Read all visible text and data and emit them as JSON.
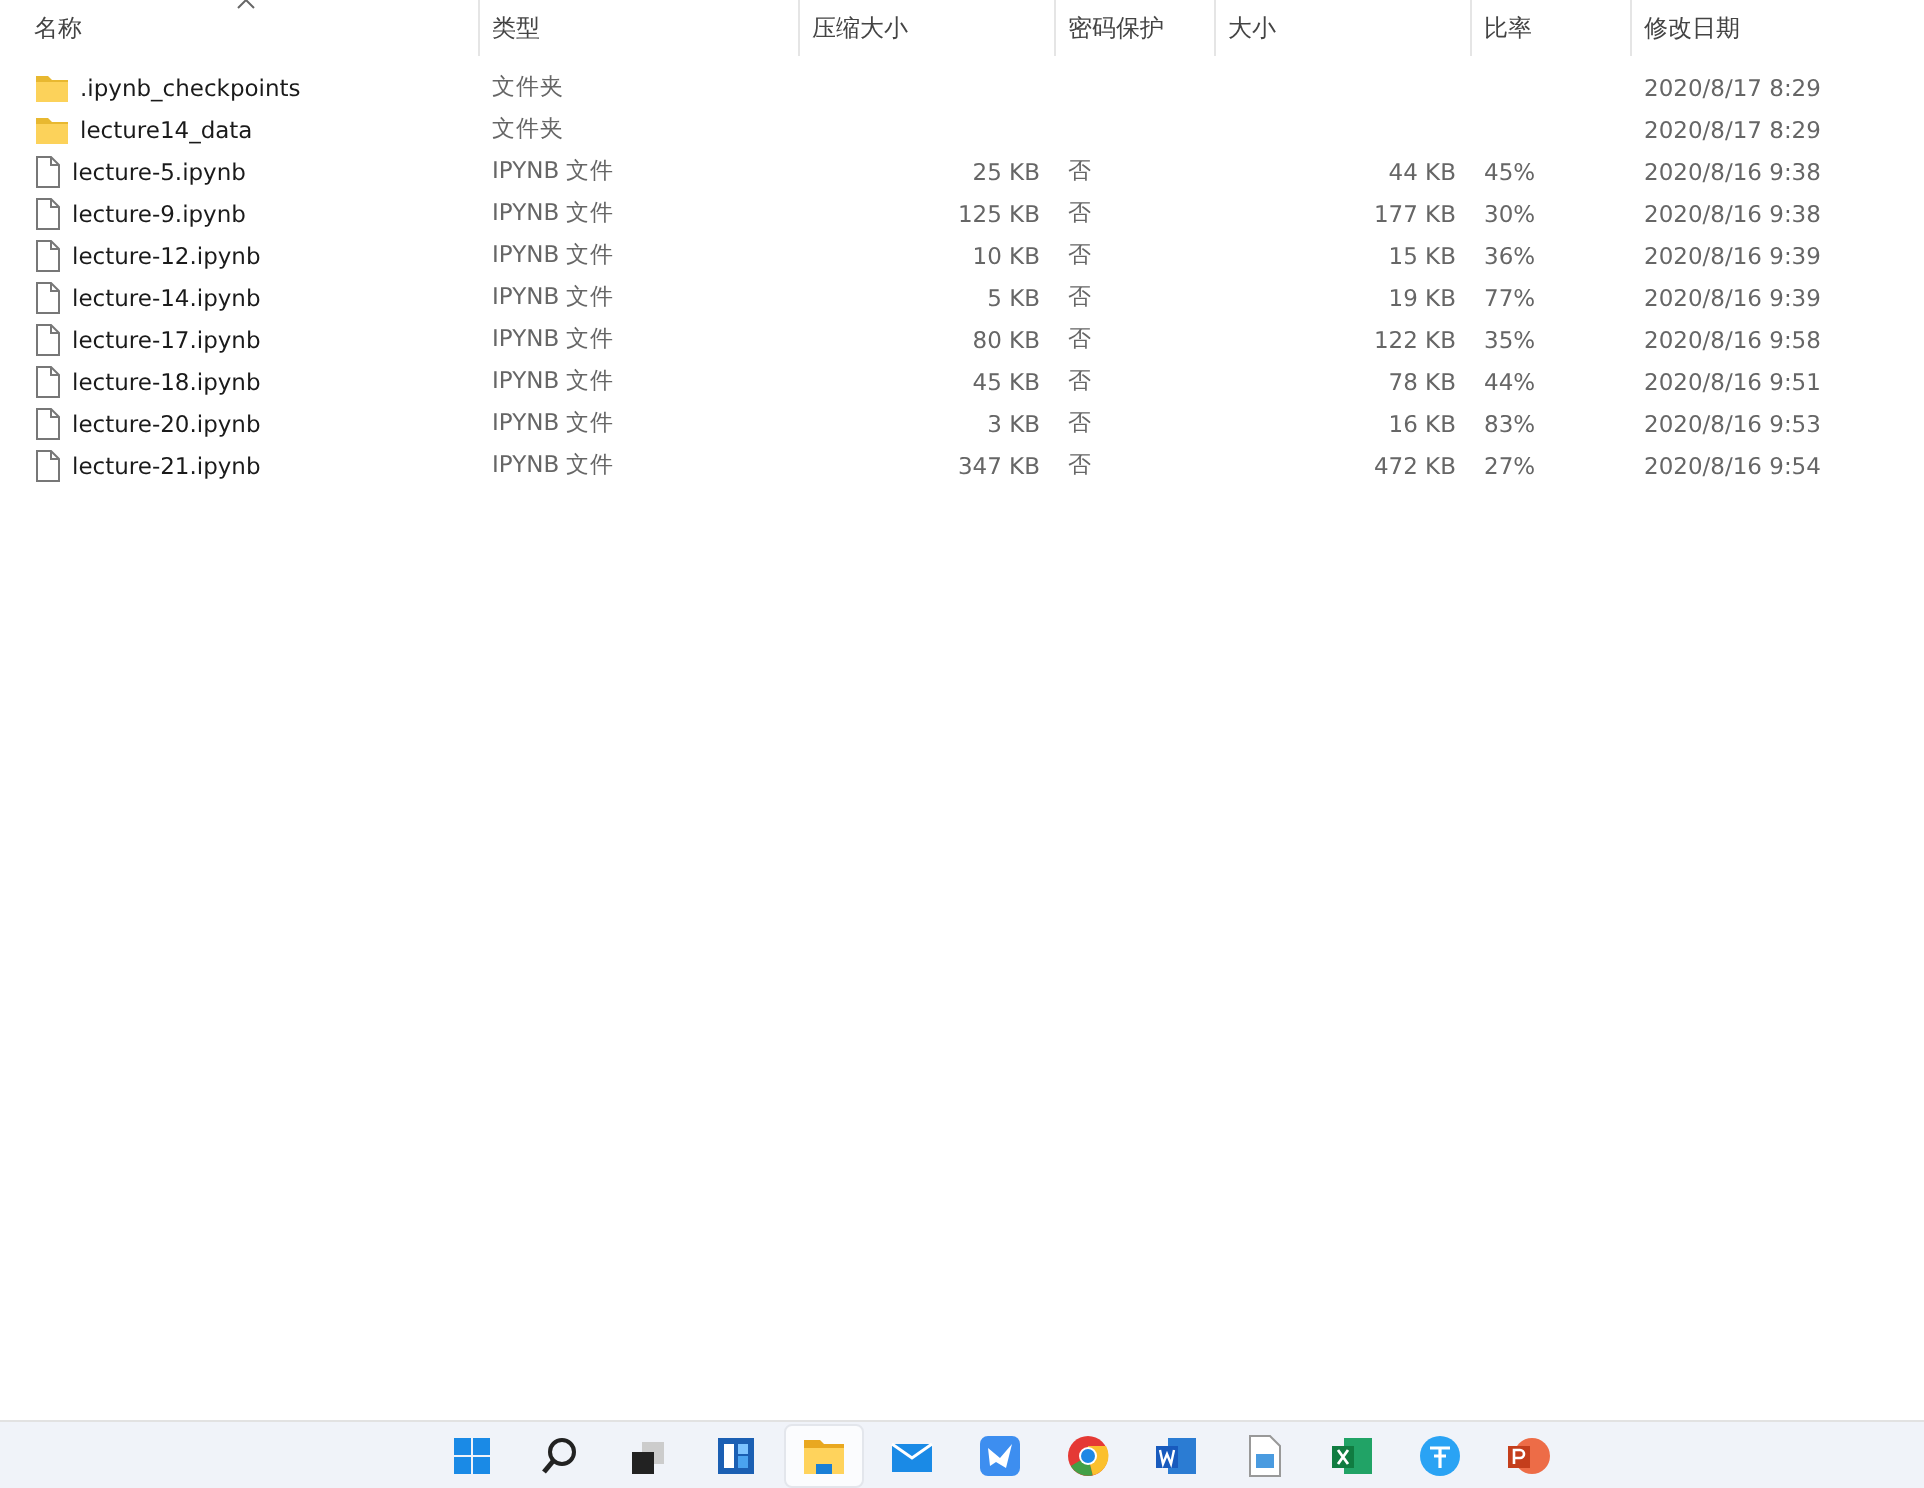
{
  "table": {
    "columns": [
      {
        "label": "名称",
        "sorted": true
      },
      {
        "label": "类型",
        "sorted": false
      },
      {
        "label": "压缩大小",
        "sorted": false
      },
      {
        "label": "密码保护",
        "sorted": false
      },
      {
        "label": "大小",
        "sorted": false
      },
      {
        "label": "比率",
        "sorted": false
      },
      {
        "label": "修改日期",
        "sorted": false
      }
    ],
    "rows": [
      {
        "kind": "folder",
        "cells": [
          ".ipynb_checkpoints",
          "文件夹",
          "",
          "",
          "",
          "",
          "2020/8/17 8:29"
        ]
      },
      {
        "kind": "folder",
        "cells": [
          "lecture14_data",
          "文件夹",
          "",
          "",
          "",
          "",
          "2020/8/17 8:29"
        ]
      },
      {
        "kind": "file",
        "cells": [
          "lecture-5.ipynb",
          "IPYNB 文件",
          "25 KB",
          "否",
          "44 KB",
          "45%",
          "2020/8/16 9:38"
        ]
      },
      {
        "kind": "file",
        "cells": [
          "lecture-9.ipynb",
          "IPYNB 文件",
          "125 KB",
          "否",
          "177 KB",
          "30%",
          "2020/8/16 9:38"
        ]
      },
      {
        "kind": "file",
        "cells": [
          "lecture-12.ipynb",
          "IPYNB 文件",
          "10 KB",
          "否",
          "15 KB",
          "36%",
          "2020/8/16 9:39"
        ]
      },
      {
        "kind": "file",
        "cells": [
          "lecture-14.ipynb",
          "IPYNB 文件",
          "5 KB",
          "否",
          "19 KB",
          "77%",
          "2020/8/16 9:39"
        ]
      },
      {
        "kind": "file",
        "cells": [
          "lecture-17.ipynb",
          "IPYNB 文件",
          "80 KB",
          "否",
          "122 KB",
          "35%",
          "2020/8/16 9:58"
        ]
      },
      {
        "kind": "file",
        "cells": [
          "lecture-18.ipynb",
          "IPYNB 文件",
          "45 KB",
          "否",
          "78 KB",
          "44%",
          "2020/8/16 9:51"
        ]
      },
      {
        "kind": "file",
        "cells": [
          "lecture-20.ipynb",
          "IPYNB 文件",
          "3 KB",
          "否",
          "16 KB",
          "83%",
          "2020/8/16 9:53"
        ]
      },
      {
        "kind": "file",
        "cells": [
          "lecture-21.ipynb",
          "IPYNB 文件",
          "347 KB",
          "否",
          "472 KB",
          "27%",
          "2020/8/16 9:54"
        ]
      }
    ]
  },
  "taskbar": {
    "items": [
      {
        "kind": "start",
        "selected": false
      },
      {
        "kind": "search",
        "selected": false
      },
      {
        "kind": "taskview",
        "selected": false
      },
      {
        "kind": "widgets",
        "selected": false
      },
      {
        "kind": "explorer",
        "selected": true
      },
      {
        "kind": "mail",
        "selected": false
      },
      {
        "kind": "bird",
        "selected": false
      },
      {
        "kind": "browser",
        "selected": false
      },
      {
        "kind": "word",
        "selected": false
      },
      {
        "kind": "photos",
        "selected": false
      },
      {
        "kind": "excel",
        "selected": false
      },
      {
        "kind": "translate",
        "selected": false
      },
      {
        "kind": "powerpoint",
        "selected": false
      }
    ]
  }
}
